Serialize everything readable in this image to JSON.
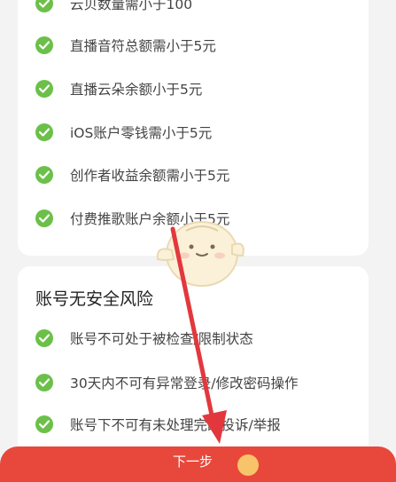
{
  "card1": {
    "items": [
      {
        "text": "云贝数量需小于100"
      },
      {
        "text": "直播音符总额需小于5元"
      },
      {
        "text": "直播云朵余额小于5元"
      },
      {
        "text": "iOS账户零钱需小于5元"
      },
      {
        "text": "创作者收益余额需小于5元"
      },
      {
        "text": "付费推歌账户余额小于5元"
      }
    ]
  },
  "card2": {
    "title": "账号无安全风险",
    "items": [
      {
        "text": "账号不可处于被检查/限制状态"
      },
      {
        "text": "30天内不可有异常登录/修改密码操作"
      },
      {
        "text": "账号下不可有未处理完的投诉/举报"
      }
    ]
  },
  "bottom_bar": {
    "label": "下一步"
  },
  "colors": {
    "check": "#6cc04a",
    "accent": "#e8483b",
    "arrow": "#e2383d"
  },
  "icons": {
    "check": "check-circle-icon",
    "mascot": "mascot-sticker-icon",
    "arrow": "arrow-annotation-icon"
  }
}
